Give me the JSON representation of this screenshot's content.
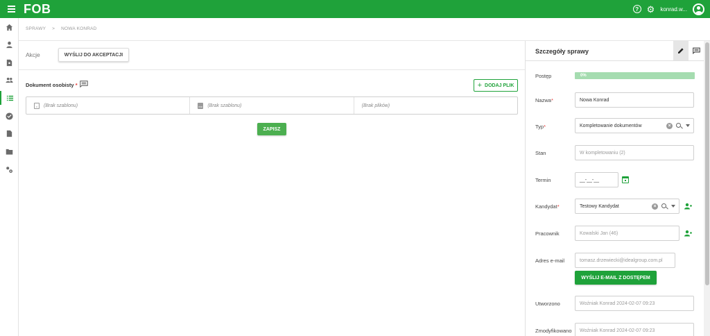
{
  "header": {
    "logo": "FOB",
    "username": "konrad.w...",
    "brand_color": "#1fa23a"
  },
  "sidebar": {
    "items": [
      {
        "icon": "home-icon"
      },
      {
        "icon": "person-icon"
      },
      {
        "icon": "person-document-icon"
      },
      {
        "icon": "people-icon"
      },
      {
        "icon": "list-icon",
        "active": true
      },
      {
        "icon": "check-circle-icon"
      },
      {
        "icon": "document-icon"
      },
      {
        "icon": "folder-icon"
      },
      {
        "icon": "settings-icon"
      }
    ]
  },
  "breadcrumb": {
    "root": "SPRAWY",
    "separator": ">",
    "current": "NOWA KONRAD"
  },
  "main": {
    "actions_label": "Akcje",
    "send_for_acceptance": "WYŚLIJ DO AKCEPTACJI",
    "document_label": "Dokument osobisty",
    "required_mark": "*",
    "add_file": "DODAJ PLIK",
    "files": [
      {
        "text": "(Brak szablonu)",
        "icon": "document-outline-icon"
      },
      {
        "text": "(Brak szablonu)",
        "icon": "document-filled-icon"
      },
      {
        "text": "(Brak plików)",
        "icon": ""
      }
    ],
    "save": "ZAPISZ"
  },
  "details": {
    "title": "Szczegóły sprawy",
    "progress_label": "Postęp",
    "progress_value": "0%",
    "name_label": "Nazwa",
    "name_value": "Nowa Konrad",
    "type_label": "Typ",
    "type_value": "Kompletowanie dokumentów",
    "state_label": "Stan",
    "state_value": "W kompletowaniu (2)",
    "deadline_label": "Termin",
    "deadline_value": "__-__-__",
    "candidate_label": "Kandydat",
    "candidate_value": "Testowy Kandydat",
    "employee_label": "Pracownik",
    "employee_value": "Kowalski Jan (46)",
    "email_label": "Adres e-mail",
    "email_value": "tomasz.drzewiecki@idealgroup.com.pl",
    "send_email": "WYŚLIJ E-MAIL Z DOSTĘPEM",
    "created_label": "Utworzono",
    "created_value": "Woźniak Konrad 2024-02-07 09:23",
    "modified_label": "Zmodyfikowano",
    "modified_value": "Woźniak Konrad 2024-02-07 09:23",
    "required_mark": "*"
  }
}
